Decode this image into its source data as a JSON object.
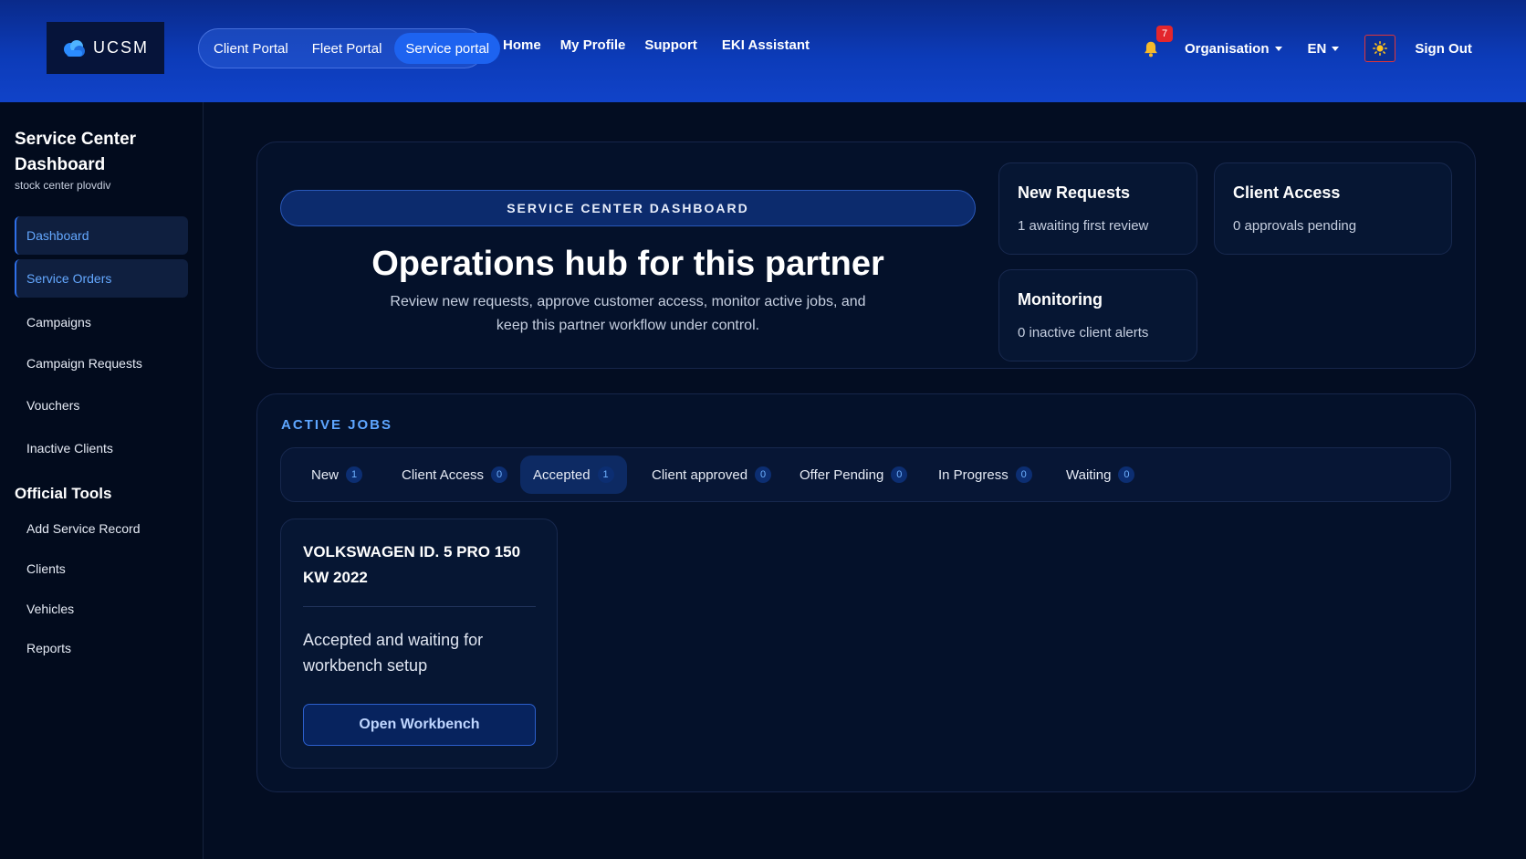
{
  "brand": {
    "logo_text": "UCSM"
  },
  "portals": [
    {
      "label": "Client Portal",
      "active": false
    },
    {
      "label": "Fleet Portal",
      "active": false
    },
    {
      "label": "Service portal",
      "active": true
    }
  ],
  "nav": {
    "home": "Home",
    "profile": "My Profile",
    "support": "Support",
    "assistant": "EKI Assistant"
  },
  "header_right": {
    "notification_count": "7",
    "organisation": "Organisation",
    "language": "EN",
    "sign_out": "Sign Out"
  },
  "sidebar": {
    "title": "Service Center Dashboard",
    "subtitle": "stock center plovdiv",
    "items": [
      "Dashboard",
      "Service Orders",
      "Campaigns",
      "Campaign Requests",
      "Vouchers",
      "Inactive Clients"
    ],
    "section_title": "Official Tools",
    "tools": [
      "Add Service Record",
      "Clients",
      "Vehicles",
      "Reports"
    ]
  },
  "hero": {
    "pill": "SERVICE CENTER DASHBOARD",
    "title": "Operations hub for this partner",
    "description": "Review new requests, approve customer access, monitor active jobs, and keep this partner workflow under control."
  },
  "stats": [
    {
      "title": "New Requests",
      "value": "1 awaiting first review"
    },
    {
      "title": "Client Access",
      "value": "0 approvals pending"
    },
    {
      "title": "Monitoring",
      "value": "0 inactive client alerts"
    }
  ],
  "jobs": {
    "label": "ACTIVE JOBS",
    "tabs": [
      {
        "label": "New",
        "count": "1"
      },
      {
        "label": "Client Access",
        "count": "0"
      },
      {
        "label": "Accepted",
        "count": "1"
      },
      {
        "label": "Client approved",
        "count": "0"
      },
      {
        "label": "Offer Pending",
        "count": "0"
      },
      {
        "label": "In Progress",
        "count": "0"
      },
      {
        "label": "Waiting",
        "count": "0"
      }
    ],
    "active_tab": "Accepted",
    "card": {
      "vehicle": "VOLKSWAGEN ID. 5 PRO 150 KW 2022",
      "status": "Accepted and waiting for workbench setup",
      "button": "Open Workbench"
    }
  },
  "colors": {
    "accent": "#1d63f0",
    "link_blue": "#5ea6ff",
    "alert_red": "#e3262c",
    "background": "#030d22"
  },
  "icons": {
    "logo": "cloud-logo-icon",
    "notifications": "bell-icon",
    "theme": "sun-icon"
  }
}
